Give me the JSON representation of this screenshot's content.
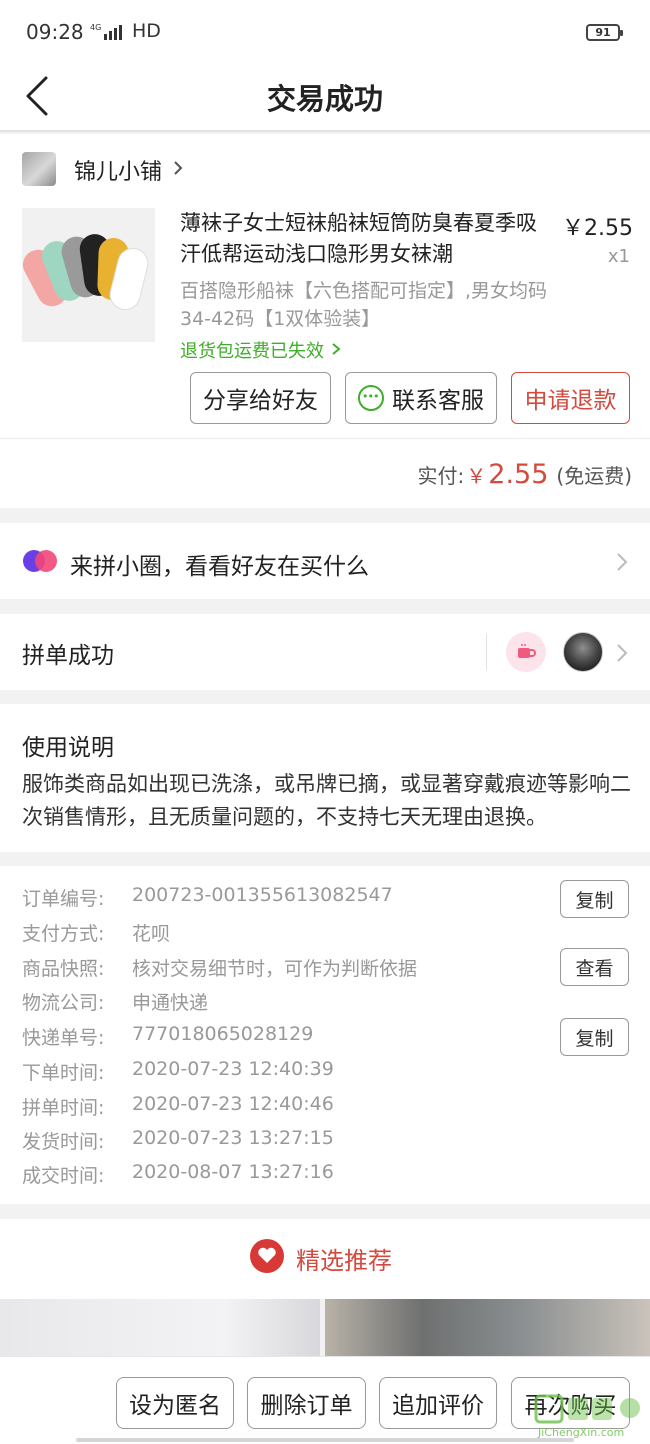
{
  "status_bar": {
    "time": "09:28",
    "network": "4G",
    "hd": "HD",
    "battery": "91"
  },
  "nav": {
    "title": "交易成功"
  },
  "shop": {
    "name": "锦儿小铺"
  },
  "product": {
    "title": "薄袜子女士短袜船袜短筒防臭春夏季吸汗低帮运动浅口隐形男女袜潮",
    "price": "￥2.55",
    "quantity": "x1",
    "spec": "百搭隐形船袜【六色搭配可指定】,男女均码34-42码【1双体验装】",
    "return_note": "退货包运费已失效"
  },
  "actions": {
    "share": "分享给好友",
    "service": "联系客服",
    "refund": "申请退款"
  },
  "total": {
    "label": "实付:",
    "currency": "￥",
    "amount": "2.55",
    "note": "(免运费)"
  },
  "circle": {
    "text": "来拼小圈，看看好友在买什么"
  },
  "group": {
    "text": "拼单成功"
  },
  "usage": {
    "title": "使用说明",
    "body": "服饰类商品如出现已洗涤，或吊牌已摘，或显著穿戴痕迹等影响二次销售情形，且无质量问题的，不支持七天无理由退换。"
  },
  "details": [
    {
      "label": "订单编号:",
      "value": "200723-001355613082547",
      "button": "复制"
    },
    {
      "label": "支付方式:",
      "value": "花呗"
    },
    {
      "label": "商品快照:",
      "value": "核对交易细节时，可作为判断依据",
      "button": "查看"
    },
    {
      "label": "物流公司:",
      "value": "申通快递"
    },
    {
      "label": "快递单号:",
      "value": "777018065028129",
      "button": "复制"
    },
    {
      "label": "下单时间:",
      "value": "2020-07-23 12:40:39"
    },
    {
      "label": "拼单时间:",
      "value": "2020-07-23 12:40:46"
    },
    {
      "label": "发货时间:",
      "value": "2020-07-23 13:27:15"
    },
    {
      "label": "成交时间:",
      "value": "2020-08-07 13:27:16"
    }
  ],
  "recommend": {
    "title": "精选推荐"
  },
  "bottom_bar": {
    "anonymous": "设为匿名",
    "delete": "删除订单",
    "review": "追加评价",
    "rebuy": "再次购买"
  },
  "watermark": {
    "text": "JiChengXin.com"
  },
  "colors": {
    "accent_red": "#d34a3e",
    "green": "#3fae29",
    "bg": "#f2f2f2"
  }
}
